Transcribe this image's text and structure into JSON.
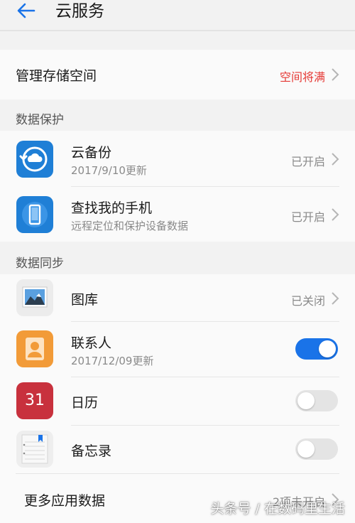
{
  "header": {
    "title": "云服务"
  },
  "storage": {
    "label": "管理存储空间",
    "status": "空间将满"
  },
  "data_protection": {
    "section_label": "数据保护",
    "items": [
      {
        "title": "云备份",
        "subtitle": "2017/9/10更新",
        "status": "已开启",
        "icon": "cloud-backup-icon"
      },
      {
        "title": "查找我的手机",
        "subtitle": "远程定位和保护设备数据",
        "status": "已开启",
        "icon": "find-phone-icon"
      }
    ]
  },
  "data_sync": {
    "section_label": "数据同步",
    "items": [
      {
        "title": "图库",
        "status": "已关闭",
        "icon": "gallery-icon"
      },
      {
        "title": "联系人",
        "subtitle": "2017/12/09更新",
        "toggle": true,
        "icon": "contacts-icon"
      },
      {
        "title": "日历",
        "toggle": false,
        "icon": "calendar-icon",
        "icon_text": "31"
      },
      {
        "title": "备忘录",
        "toggle": false,
        "icon": "notepad-icon"
      }
    ]
  },
  "more": {
    "label": "更多应用数据",
    "status": "2项未开启"
  },
  "watermark": "头条号 / 在数码里生活",
  "colors": {
    "accent": "#1a73e8",
    "warning": "#e53935",
    "background": "#f2f2f2",
    "card": "#fafafa"
  }
}
